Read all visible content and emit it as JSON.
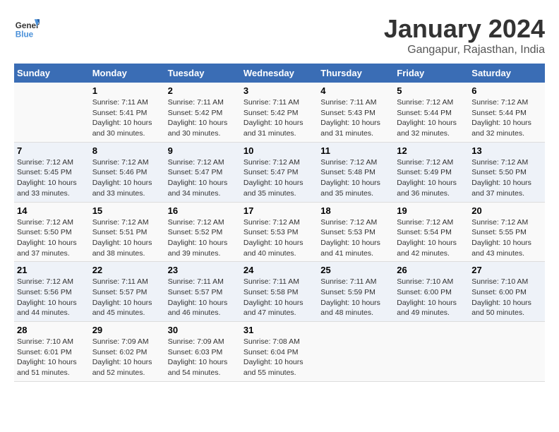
{
  "header": {
    "logo_line1": "General",
    "logo_line2": "Blue",
    "title": "January 2024",
    "subtitle": "Gangapur, Rajasthan, India"
  },
  "days_of_week": [
    "Sunday",
    "Monday",
    "Tuesday",
    "Wednesday",
    "Thursday",
    "Friday",
    "Saturday"
  ],
  "weeks": [
    [
      {
        "num": "",
        "detail": ""
      },
      {
        "num": "1",
        "detail": "Sunrise: 7:11 AM\nSunset: 5:41 PM\nDaylight: 10 hours\nand 30 minutes."
      },
      {
        "num": "2",
        "detail": "Sunrise: 7:11 AM\nSunset: 5:42 PM\nDaylight: 10 hours\nand 30 minutes."
      },
      {
        "num": "3",
        "detail": "Sunrise: 7:11 AM\nSunset: 5:42 PM\nDaylight: 10 hours\nand 31 minutes."
      },
      {
        "num": "4",
        "detail": "Sunrise: 7:11 AM\nSunset: 5:43 PM\nDaylight: 10 hours\nand 31 minutes."
      },
      {
        "num": "5",
        "detail": "Sunrise: 7:12 AM\nSunset: 5:44 PM\nDaylight: 10 hours\nand 32 minutes."
      },
      {
        "num": "6",
        "detail": "Sunrise: 7:12 AM\nSunset: 5:44 PM\nDaylight: 10 hours\nand 32 minutes."
      }
    ],
    [
      {
        "num": "7",
        "detail": "Sunrise: 7:12 AM\nSunset: 5:45 PM\nDaylight: 10 hours\nand 33 minutes."
      },
      {
        "num": "8",
        "detail": "Sunrise: 7:12 AM\nSunset: 5:46 PM\nDaylight: 10 hours\nand 33 minutes."
      },
      {
        "num": "9",
        "detail": "Sunrise: 7:12 AM\nSunset: 5:47 PM\nDaylight: 10 hours\nand 34 minutes."
      },
      {
        "num": "10",
        "detail": "Sunrise: 7:12 AM\nSunset: 5:47 PM\nDaylight: 10 hours\nand 35 minutes."
      },
      {
        "num": "11",
        "detail": "Sunrise: 7:12 AM\nSunset: 5:48 PM\nDaylight: 10 hours\nand 35 minutes."
      },
      {
        "num": "12",
        "detail": "Sunrise: 7:12 AM\nSunset: 5:49 PM\nDaylight: 10 hours\nand 36 minutes."
      },
      {
        "num": "13",
        "detail": "Sunrise: 7:12 AM\nSunset: 5:50 PM\nDaylight: 10 hours\nand 37 minutes."
      }
    ],
    [
      {
        "num": "14",
        "detail": "Sunrise: 7:12 AM\nSunset: 5:50 PM\nDaylight: 10 hours\nand 37 minutes."
      },
      {
        "num": "15",
        "detail": "Sunrise: 7:12 AM\nSunset: 5:51 PM\nDaylight: 10 hours\nand 38 minutes."
      },
      {
        "num": "16",
        "detail": "Sunrise: 7:12 AM\nSunset: 5:52 PM\nDaylight: 10 hours\nand 39 minutes."
      },
      {
        "num": "17",
        "detail": "Sunrise: 7:12 AM\nSunset: 5:53 PM\nDaylight: 10 hours\nand 40 minutes."
      },
      {
        "num": "18",
        "detail": "Sunrise: 7:12 AM\nSunset: 5:53 PM\nDaylight: 10 hours\nand 41 minutes."
      },
      {
        "num": "19",
        "detail": "Sunrise: 7:12 AM\nSunset: 5:54 PM\nDaylight: 10 hours\nand 42 minutes."
      },
      {
        "num": "20",
        "detail": "Sunrise: 7:12 AM\nSunset: 5:55 PM\nDaylight: 10 hours\nand 43 minutes."
      }
    ],
    [
      {
        "num": "21",
        "detail": "Sunrise: 7:12 AM\nSunset: 5:56 PM\nDaylight: 10 hours\nand 44 minutes."
      },
      {
        "num": "22",
        "detail": "Sunrise: 7:11 AM\nSunset: 5:57 PM\nDaylight: 10 hours\nand 45 minutes."
      },
      {
        "num": "23",
        "detail": "Sunrise: 7:11 AM\nSunset: 5:57 PM\nDaylight: 10 hours\nand 46 minutes."
      },
      {
        "num": "24",
        "detail": "Sunrise: 7:11 AM\nSunset: 5:58 PM\nDaylight: 10 hours\nand 47 minutes."
      },
      {
        "num": "25",
        "detail": "Sunrise: 7:11 AM\nSunset: 5:59 PM\nDaylight: 10 hours\nand 48 minutes."
      },
      {
        "num": "26",
        "detail": "Sunrise: 7:10 AM\nSunset: 6:00 PM\nDaylight: 10 hours\nand 49 minutes."
      },
      {
        "num": "27",
        "detail": "Sunrise: 7:10 AM\nSunset: 6:00 PM\nDaylight: 10 hours\nand 50 minutes."
      }
    ],
    [
      {
        "num": "28",
        "detail": "Sunrise: 7:10 AM\nSunset: 6:01 PM\nDaylight: 10 hours\nand 51 minutes."
      },
      {
        "num": "29",
        "detail": "Sunrise: 7:09 AM\nSunset: 6:02 PM\nDaylight: 10 hours\nand 52 minutes."
      },
      {
        "num": "30",
        "detail": "Sunrise: 7:09 AM\nSunset: 6:03 PM\nDaylight: 10 hours\nand 54 minutes."
      },
      {
        "num": "31",
        "detail": "Sunrise: 7:08 AM\nSunset: 6:04 PM\nDaylight: 10 hours\nand 55 minutes."
      },
      {
        "num": "",
        "detail": ""
      },
      {
        "num": "",
        "detail": ""
      },
      {
        "num": "",
        "detail": ""
      }
    ]
  ]
}
